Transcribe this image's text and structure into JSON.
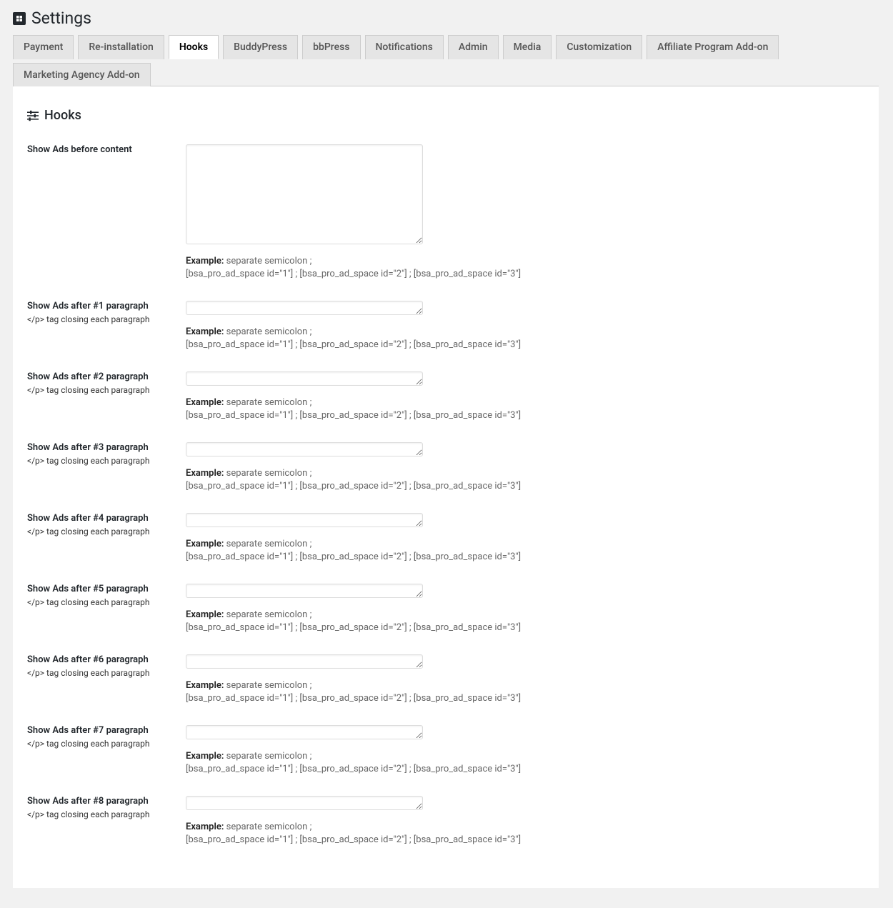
{
  "page_title": "Settings",
  "tabs": [
    {
      "id": "payment",
      "label": "Payment",
      "active": false
    },
    {
      "id": "reinstallation",
      "label": "Re-installation",
      "active": false
    },
    {
      "id": "hooks",
      "label": "Hooks",
      "active": true
    },
    {
      "id": "buddypress",
      "label": "BuddyPress",
      "active": false
    },
    {
      "id": "bbpress",
      "label": "bbPress",
      "active": false
    },
    {
      "id": "notifications",
      "label": "Notifications",
      "active": false
    },
    {
      "id": "admin",
      "label": "Admin",
      "active": false
    },
    {
      "id": "media",
      "label": "Media",
      "active": false
    },
    {
      "id": "customization",
      "label": "Customization",
      "active": false
    },
    {
      "id": "affiliate",
      "label": "Affiliate Program Add-on",
      "active": false
    },
    {
      "id": "marketing",
      "label": "Marketing Agency Add-on",
      "active": false
    }
  ],
  "section_title": "Hooks",
  "example": {
    "label": "Example:",
    "desc": "separate semicolon ;",
    "code": "[bsa_pro_ad_space id=\"1\"] ; [bsa_pro_ad_space id=\"2\"] ; [bsa_pro_ad_space id=\"3\"]"
  },
  "subtext_closing": "</p> tag closing each paragraph",
  "fields": [
    {
      "id": "before_content",
      "label": "Show Ads before content",
      "sub": "",
      "value": "",
      "big": true
    },
    {
      "id": "after_p1",
      "label": "Show Ads after #1 paragraph",
      "sub": true,
      "value": "",
      "big": false
    },
    {
      "id": "after_p2",
      "label": "Show Ads after #2 paragraph",
      "sub": true,
      "value": "",
      "big": false
    },
    {
      "id": "after_p3",
      "label": "Show Ads after #3 paragraph",
      "sub": true,
      "value": "",
      "big": false
    },
    {
      "id": "after_p4",
      "label": "Show Ads after #4 paragraph",
      "sub": true,
      "value": "",
      "big": false
    },
    {
      "id": "after_p5",
      "label": "Show Ads after #5 paragraph",
      "sub": true,
      "value": "",
      "big": false
    },
    {
      "id": "after_p6",
      "label": "Show Ads after #6 paragraph",
      "sub": true,
      "value": "",
      "big": false
    },
    {
      "id": "after_p7",
      "label": "Show Ads after #7 paragraph",
      "sub": true,
      "value": "",
      "big": false
    },
    {
      "id": "after_p8",
      "label": "Show Ads after #8 paragraph",
      "sub": true,
      "value": "",
      "big": false
    }
  ]
}
